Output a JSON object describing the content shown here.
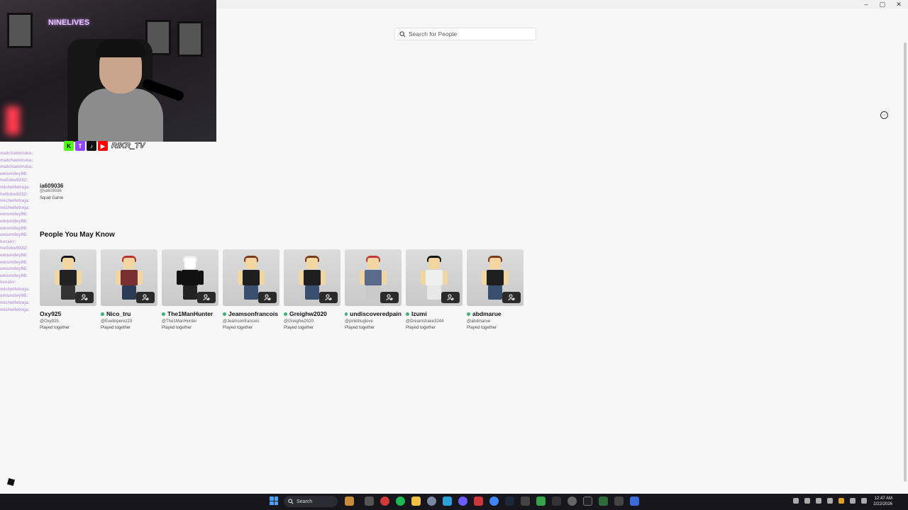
{
  "window": {
    "minimize": "–",
    "maximize": "▢",
    "close": "✕"
  },
  "search": {
    "placeholder": "Search for People"
  },
  "overlay": {
    "neon_sign": "NINELIVES",
    "social_handle": "RIKR_TV",
    "chat": [
      {
        "user": "matchamiruka:",
        "msg": ""
      },
      {
        "user": "matchamiruka:",
        "msg": ""
      },
      {
        "user": "matchamiruka:",
        "msg": ""
      },
      {
        "user": "emsmiley98:",
        "msg": ""
      },
      {
        "user": "hellobe9332:",
        "msg": ""
      },
      {
        "user": "michelletreja:",
        "msg": ""
      },
      {
        "user": "hellobe9332:",
        "msg": ""
      },
      {
        "user": "michelletreja:",
        "msg": ""
      },
      {
        "user": "michelletreja:",
        "msg": ""
      },
      {
        "user": "emsmiley98:",
        "msg": ""
      },
      {
        "user": "emsmiley98:",
        "msg": ""
      },
      {
        "user": "emsmiley98:",
        "msg": ""
      },
      {
        "user": "emsmiley98:",
        "msg": ""
      },
      {
        "user": "korairr:",
        "msg": ""
      },
      {
        "user": "hellobe9332:",
        "msg": ""
      },
      {
        "user": "emsmiley98:",
        "msg": ""
      },
      {
        "user": "emsmiley98:",
        "msg": ""
      },
      {
        "user": "emsmiley98:",
        "msg": ""
      },
      {
        "user": "emsmiley98:",
        "msg": ""
      },
      {
        "user": "korairr:",
        "msg": ""
      },
      {
        "user": "michelletreja:",
        "msg": ""
      },
      {
        "user": "emsmiley98:",
        "msg": ""
      },
      {
        "user": "michelletreja:",
        "msg": ""
      },
      {
        "user": "michelletreja:",
        "msg": ""
      }
    ]
  },
  "profile_ghost": {
    "name": "ia609036",
    "handle": "@ia609036",
    "status": "Squid Game"
  },
  "section_title": "People You May Know",
  "people": [
    {
      "name": "Oxy925",
      "username": "@Oxy925",
      "played": "Played together",
      "online": false
    },
    {
      "name": "Nico_tru",
      "username": "@Evelinperez23",
      "played": "Played together",
      "online": true
    },
    {
      "name": "The1ManHunter",
      "username": "@The1ManHunter",
      "played": "Played together",
      "online": true
    },
    {
      "name": "Jeamsonfrancois",
      "username": "@Jeamsonfrancois",
      "played": "Played together",
      "online": true
    },
    {
      "name": "Greighw2020",
      "username": "@Greighw2020",
      "played": "Played together",
      "online": true
    },
    {
      "name": "undiscoveredpain",
      "username": "@pinkthuglove",
      "played": "Played together",
      "online": true
    },
    {
      "name": "Izumi",
      "username": "@Dreamshake3244",
      "played": "Played together",
      "online": true
    },
    {
      "name": "abdmarue",
      "username": "@abdmarue",
      "played": "Played together",
      "online": true
    }
  ],
  "taskbar": {
    "search_label": "Search",
    "time": "12:47 AM",
    "date": "2/22/2026"
  },
  "colors": {
    "accent_online": "#3bb273",
    "taskbar_bg": "#16161c"
  }
}
